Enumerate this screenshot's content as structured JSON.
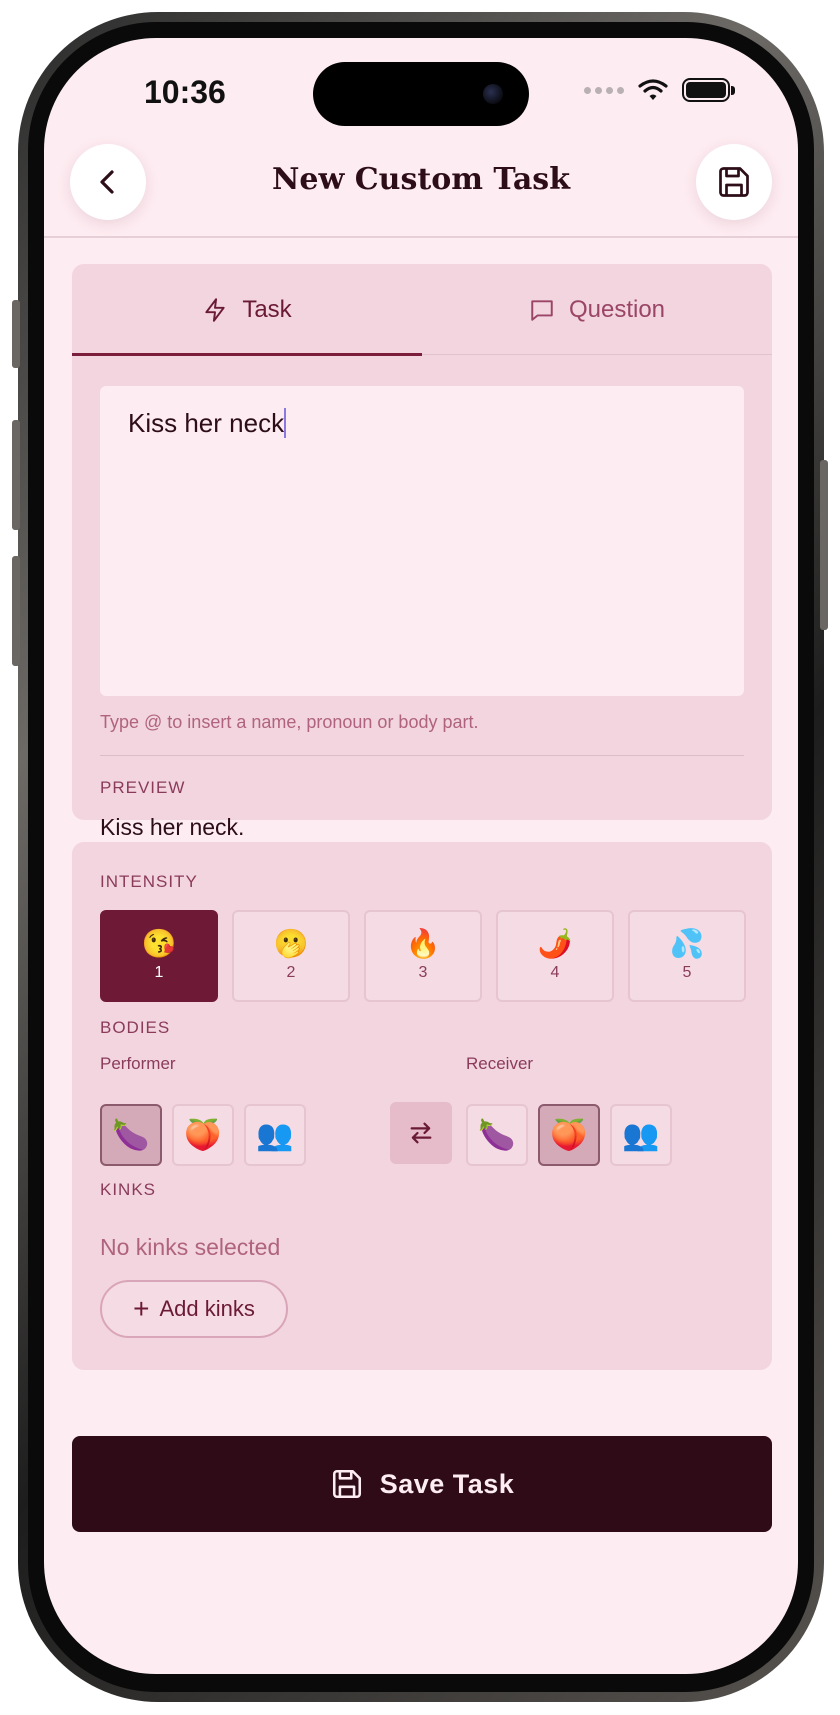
{
  "status_bar": {
    "time": "10:36"
  },
  "header": {
    "title": "New Custom Task",
    "back_icon": "chevron-left-icon",
    "save_icon": "floppy-disk-icon"
  },
  "tabs": [
    {
      "label": "Task",
      "icon": "lightning-icon",
      "selected": true
    },
    {
      "label": "Question",
      "icon": "speech-bubble-icon",
      "selected": false
    }
  ],
  "editor": {
    "value": "Kiss her neck",
    "helper": "Type @ to insert a name, pronoun or body part."
  },
  "preview": {
    "label": "PREVIEW",
    "text": "Kiss her neck."
  },
  "intensity": {
    "label": "INTENSITY",
    "selected": 1,
    "levels": [
      {
        "emoji": "😘",
        "number": "1"
      },
      {
        "emoji": "🫢",
        "number": "2"
      },
      {
        "emoji": "🔥",
        "number": "3"
      },
      {
        "emoji": "🌶️",
        "number": "4"
      },
      {
        "emoji": "💦",
        "number": "5"
      }
    ]
  },
  "bodies": {
    "label": "BODIES",
    "performer": {
      "label": "Performer",
      "options": [
        {
          "emoji": "🍆",
          "selected": true
        },
        {
          "emoji": "🍑",
          "selected": false
        },
        {
          "emoji": "👥",
          "selected": false
        }
      ]
    },
    "swap_icon": "swap-arrows-icon",
    "receiver": {
      "label": "Receiver",
      "options": [
        {
          "emoji": "🍆",
          "selected": false
        },
        {
          "emoji": "🍑",
          "selected": true
        },
        {
          "emoji": "👥",
          "selected": false
        }
      ]
    }
  },
  "kinks": {
    "label": "KINKS",
    "empty_text": "No kinks selected",
    "add_label": "Add kinks"
  },
  "save_button": {
    "label": "Save Task",
    "icon": "floppy-disk-icon"
  },
  "colors": {
    "background": "#fdecf1",
    "card": "#f2d5df",
    "accent": "#6e1a37",
    "primary_dark": "#2e0b16"
  }
}
